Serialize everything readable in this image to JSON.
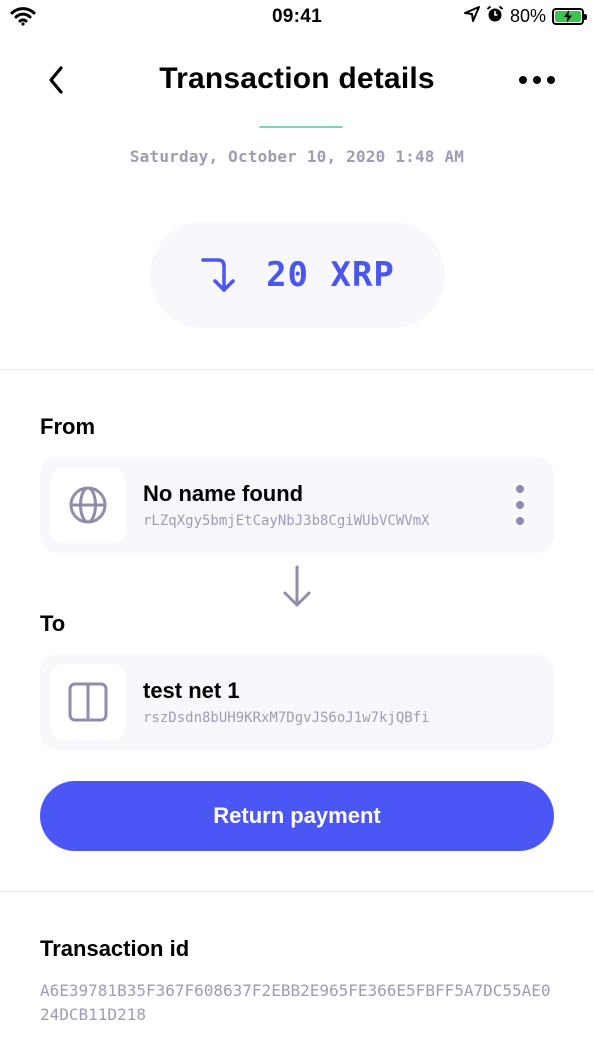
{
  "status_bar": {
    "time": "09:41",
    "battery": "80%",
    "battery_level": 0.8
  },
  "header": {
    "title": "Transaction details"
  },
  "transaction": {
    "date": "Saturday, October 10, 2020 1:48 AM",
    "amount": "20 XRP"
  },
  "from": {
    "label": "From",
    "name": "No name found",
    "address": "rLZqXgy5bmjEtCayNbJ3b8CgiWUbVCWVmX",
    "icon": "globe-icon"
  },
  "to": {
    "label": "To",
    "name": "test net 1",
    "address": "rszDsdn8bUH9KRxM7DgvJS6oJ1w7kjQBfi",
    "icon": "wallet-icon"
  },
  "actions": {
    "return_payment": "Return payment"
  },
  "transaction_id": {
    "label": "Transaction id",
    "value": "A6E39781B35F367F608637F2EBB2E965FE366E5FBFF5A7DC55AE024DCB11D218"
  },
  "colors": {
    "accent": "#4B56F6",
    "muted": "#9D9DB3",
    "card": "#F7F7FC"
  }
}
